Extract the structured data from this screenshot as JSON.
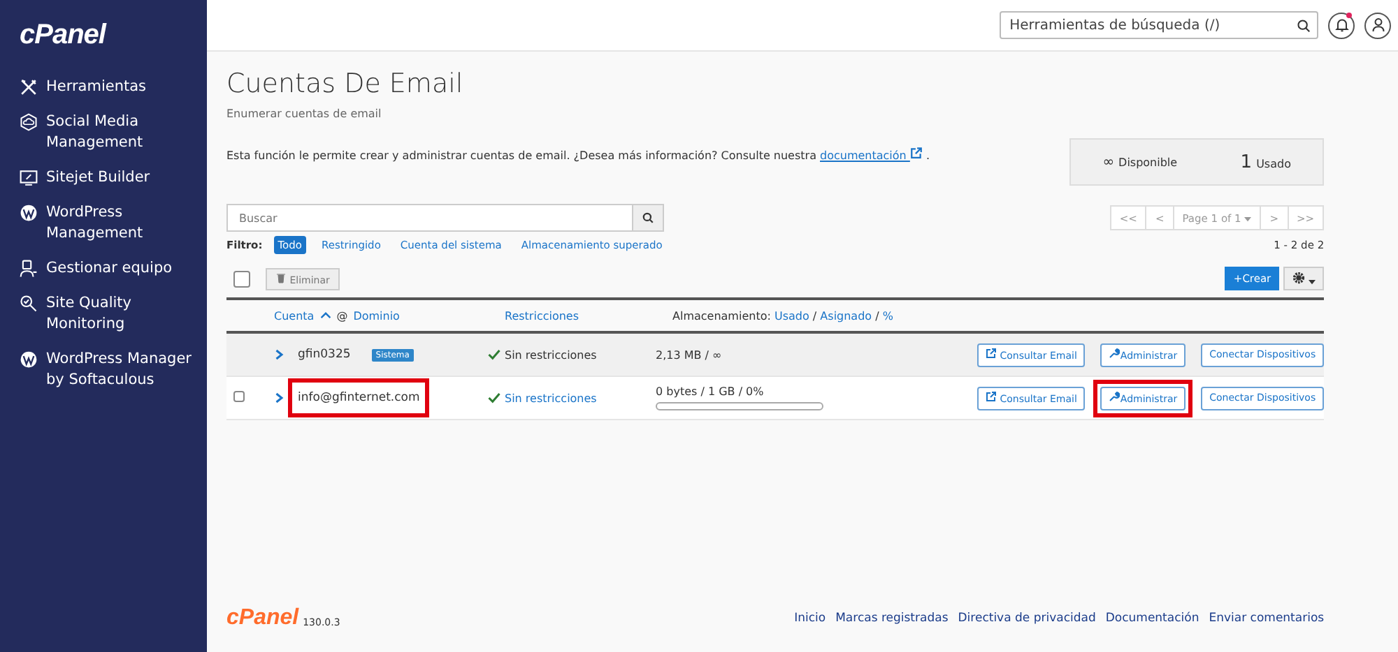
{
  "sidebar": {
    "logo": "cPanel",
    "items": [
      {
        "label": "Herramientas"
      },
      {
        "label": "Social Media Management"
      },
      {
        "label": "Sitejet Builder"
      },
      {
        "label": "WordPress Management"
      },
      {
        "label": "Gestionar equipo"
      },
      {
        "label": "Site Quality Monitoring"
      },
      {
        "label": "WordPress Manager by Softaculous"
      }
    ]
  },
  "header": {
    "search": {
      "placeholder": "Herramientas de búsqueda (/)"
    },
    "notification_dot": true
  },
  "page": {
    "title": "Cuentas De Email",
    "subtitle": "Enumerar cuentas de email",
    "intro": "Esta función le permite crear y administrar cuentas de email. ¿Desea más información? Consulte nuestra",
    "intro_link": "documentación",
    "intro_end": ".",
    "stats": [
      {
        "value": "∞",
        "label": "Disponible"
      },
      {
        "value": "1",
        "label": "Usado"
      }
    ],
    "search": {
      "placeholder": "Buscar"
    },
    "pager": {
      "first": "<<",
      "prev": "<",
      "page": "Page 1 of 1",
      "next": ">",
      "last": ">>",
      "count": "1 - 2 de 2"
    },
    "filter": {
      "label": "Filtro:",
      "options": [
        {
          "label": "Todo",
          "selected": true
        },
        {
          "label": "Restringido",
          "selected": false
        },
        {
          "label": "Cuenta del sistema",
          "selected": false
        },
        {
          "label": "Almacenamiento superado",
          "selected": false
        }
      ]
    },
    "select_all": {
      "checked": false
    },
    "delete_button": "Eliminar",
    "create_button": "+Crear",
    "columns": {
      "account": "Cuenta",
      "at": "@",
      "domain": "Dominio",
      "restrictions": "Restricciones",
      "storage": "Almacenamiento:",
      "used": "Usado",
      "assigned": "Asignado",
      "percent": "%",
      "separators": [
        "/",
        "/"
      ]
    },
    "rows": [
      {
        "selectable": false,
        "account": "gfin0325",
        "badge": "Sistema",
        "restrictions": "Sin restricciones",
        "restrictions_link": false,
        "storage": "2,13 MB / ∞",
        "account_highlighted": false,
        "manage_highlighted": false,
        "buttons": [
          "Consultar Email",
          "Administrar",
          "Conectar Dispositivos"
        ]
      },
      {
        "selectable": true,
        "checked": false,
        "account": "info@gfinternet.com",
        "restrictions": "Sin restricciones",
        "restrictions_link": true,
        "storage": "0 bytes / 1 GB / 0%",
        "level": 0,
        "account_highlighted": true,
        "manage_highlighted": true,
        "buttons": [
          "Consultar Email",
          "Administrar",
          "Conectar Dispositivos"
        ]
      }
    ]
  },
  "footer": {
    "logo": "cPanel",
    "version": "130.0.3",
    "links": [
      "Inicio",
      "Marcas registradas",
      "Directiva de privacidad",
      "Documentación",
      "Enviar comentarios"
    ]
  }
}
